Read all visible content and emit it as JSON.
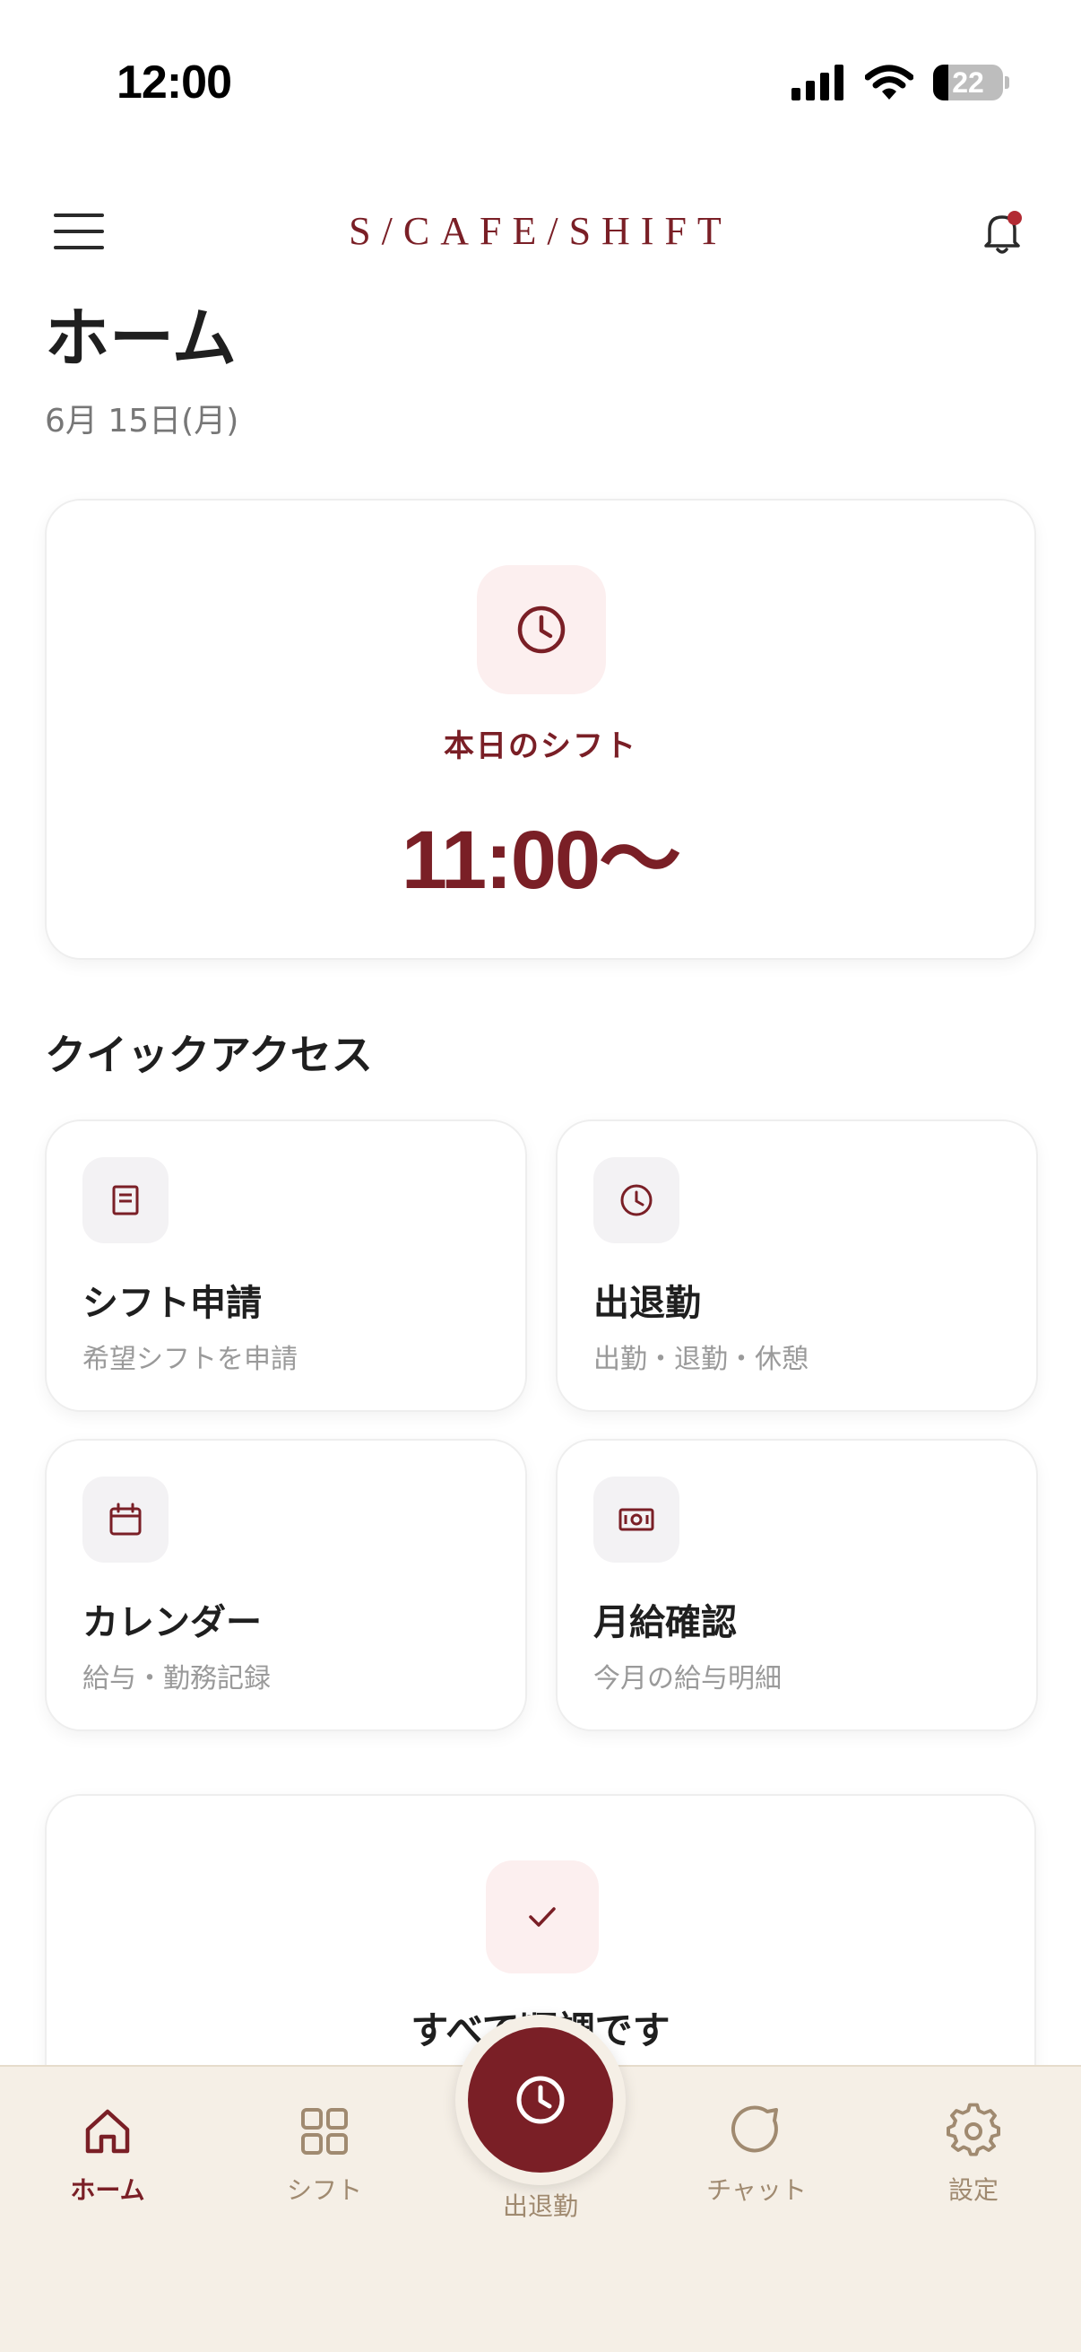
{
  "status_bar": {
    "time": "12:00",
    "battery": "22"
  },
  "header": {
    "logo": "S/CAFE/SHIFT"
  },
  "page": {
    "title": "ホーム",
    "date": "6月 15日(月)"
  },
  "today_shift": {
    "label": "本日のシフト",
    "time": "11:00〜"
  },
  "quick_access": {
    "title": "クイックアクセス",
    "items": [
      {
        "title": "シフト申請",
        "subtitle": "希望シフトを申請",
        "icon": "document-icon"
      },
      {
        "title": "出退勤",
        "subtitle": "出勤・退勤・休憩",
        "icon": "clock-icon"
      },
      {
        "title": "カレンダー",
        "subtitle": "給与・勤務記録",
        "icon": "calendar-icon"
      },
      {
        "title": "月給確認",
        "subtitle": "今月の給与明細",
        "icon": "money-icon"
      }
    ]
  },
  "status_card": {
    "text": "すべて順調です",
    "icon": "check-icon"
  },
  "bottom_nav": {
    "items": [
      {
        "label": "ホーム",
        "icon": "home-icon",
        "active": true
      },
      {
        "label": "シフト",
        "icon": "grid-icon"
      },
      {
        "label": "出退勤",
        "icon": "clock-icon"
      },
      {
        "label": "チャット",
        "icon": "chat-icon"
      },
      {
        "label": "設定",
        "icon": "gear-icon"
      }
    ]
  },
  "colors": {
    "accent": "#7a1f26",
    "nav_bg": "#f5efe6",
    "icon_bg_pink": "#fcefef"
  }
}
